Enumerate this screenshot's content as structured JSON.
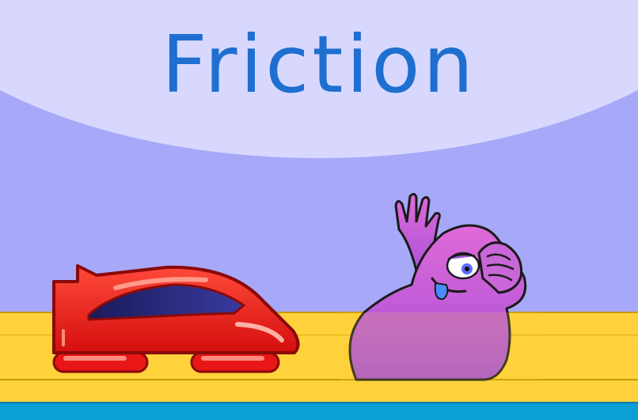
{
  "title": "Friction",
  "colors": {
    "sky": "#a8a8f8",
    "banner": "#d8d8ff",
    "title": "#1f6fd0",
    "track": "#ffd23c",
    "track_edge": "#0b9fd6",
    "car_body": "#ee1c1c",
    "blob_body": "#c24fd8"
  },
  "characters": {
    "car": "red-hover-car",
    "creature": "purple-waving-creature"
  }
}
